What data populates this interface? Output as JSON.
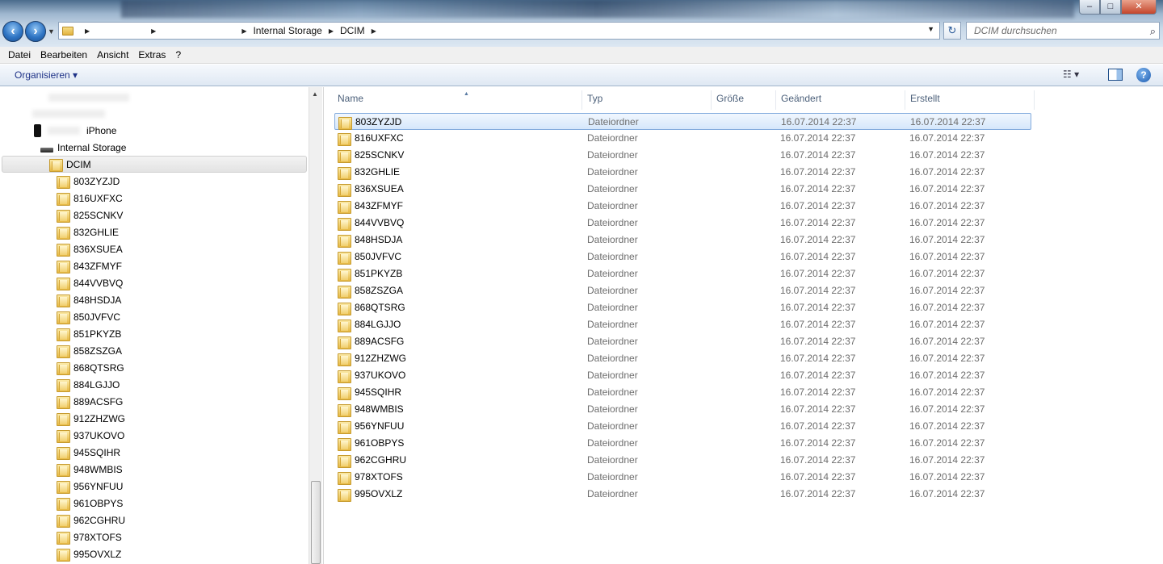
{
  "window": {
    "buttons": {
      "minimize": "–",
      "maximize": "□",
      "close": "✕"
    }
  },
  "address": {
    "crumbs": [
      "Internal Storage",
      "DCIM"
    ],
    "dropdown_icon": "chevron-down-icon"
  },
  "search": {
    "placeholder": "DCIM durchsuchen"
  },
  "menu": [
    "Datei",
    "Bearbeiten",
    "Ansicht",
    "Extras",
    "?"
  ],
  "commandbar": {
    "organize_label": "Organisieren ▾"
  },
  "nav": {
    "iphone_label": "iPhone",
    "internal_storage_label": "Internal Storage",
    "dcim_label": "DCIM",
    "folders": [
      "803ZYZJD",
      "816UXFXC",
      "825SCNKV",
      "832GHLIE",
      "836XSUEA",
      "843ZFMYF",
      "844VVBVQ",
      "848HSDJA",
      "850JVFVC",
      "851PKYZB",
      "858ZSZGA",
      "868QTSRG",
      "884LGJJO",
      "889ACSFG",
      "912ZHZWG",
      "937UKOVO",
      "945SQIHR",
      "948WMBIS",
      "956YNFUU",
      "961OBPYS",
      "962CGHRU",
      "978XTOFS",
      "995OVXLZ"
    ]
  },
  "columns": {
    "name": "Name",
    "type": "Typ",
    "size": "Größe",
    "modified": "Geändert",
    "created": "Erstellt"
  },
  "files": [
    {
      "name": "803ZYZJD",
      "type": "Dateiordner",
      "modified": "16.07.2014 22:37",
      "created": "16.07.2014 22:37"
    },
    {
      "name": "816UXFXC",
      "type": "Dateiordner",
      "modified": "16.07.2014 22:37",
      "created": "16.07.2014 22:37"
    },
    {
      "name": "825SCNKV",
      "type": "Dateiordner",
      "modified": "16.07.2014 22:37",
      "created": "16.07.2014 22:37"
    },
    {
      "name": "832GHLIE",
      "type": "Dateiordner",
      "modified": "16.07.2014 22:37",
      "created": "16.07.2014 22:37"
    },
    {
      "name": "836XSUEA",
      "type": "Dateiordner",
      "modified": "16.07.2014 22:37",
      "created": "16.07.2014 22:37"
    },
    {
      "name": "843ZFMYF",
      "type": "Dateiordner",
      "modified": "16.07.2014 22:37",
      "created": "16.07.2014 22:37"
    },
    {
      "name": "844VVBVQ",
      "type": "Dateiordner",
      "modified": "16.07.2014 22:37",
      "created": "16.07.2014 22:37"
    },
    {
      "name": "848HSDJA",
      "type": "Dateiordner",
      "modified": "16.07.2014 22:37",
      "created": "16.07.2014 22:37"
    },
    {
      "name": "850JVFVC",
      "type": "Dateiordner",
      "modified": "16.07.2014 22:37",
      "created": "16.07.2014 22:37"
    },
    {
      "name": "851PKYZB",
      "type": "Dateiordner",
      "modified": "16.07.2014 22:37",
      "created": "16.07.2014 22:37"
    },
    {
      "name": "858ZSZGA",
      "type": "Dateiordner",
      "modified": "16.07.2014 22:37",
      "created": "16.07.2014 22:37"
    },
    {
      "name": "868QTSRG",
      "type": "Dateiordner",
      "modified": "16.07.2014 22:37",
      "created": "16.07.2014 22:37"
    },
    {
      "name": "884LGJJO",
      "type": "Dateiordner",
      "modified": "16.07.2014 22:37",
      "created": "16.07.2014 22:37"
    },
    {
      "name": "889ACSFG",
      "type": "Dateiordner",
      "modified": "16.07.2014 22:37",
      "created": "16.07.2014 22:37"
    },
    {
      "name": "912ZHZWG",
      "type": "Dateiordner",
      "modified": "16.07.2014 22:37",
      "created": "16.07.2014 22:37"
    },
    {
      "name": "937UKOVO",
      "type": "Dateiordner",
      "modified": "16.07.2014 22:37",
      "created": "16.07.2014 22:37"
    },
    {
      "name": "945SQIHR",
      "type": "Dateiordner",
      "modified": "16.07.2014 22:37",
      "created": "16.07.2014 22:37"
    },
    {
      "name": "948WMBIS",
      "type": "Dateiordner",
      "modified": "16.07.2014 22:37",
      "created": "16.07.2014 22:37"
    },
    {
      "name": "956YNFUU",
      "type": "Dateiordner",
      "modified": "16.07.2014 22:37",
      "created": "16.07.2014 22:37"
    },
    {
      "name": "961OBPYS",
      "type": "Dateiordner",
      "modified": "16.07.2014 22:37",
      "created": "16.07.2014 22:37"
    },
    {
      "name": "962CGHRU",
      "type": "Dateiordner",
      "modified": "16.07.2014 22:37",
      "created": "16.07.2014 22:37"
    },
    {
      "name": "978XTOFS",
      "type": "Dateiordner",
      "modified": "16.07.2014 22:37",
      "created": "16.07.2014 22:37"
    },
    {
      "name": "995OVXLZ",
      "type": "Dateiordner",
      "modified": "16.07.2014 22:37",
      "created": "16.07.2014 22:37"
    }
  ],
  "selected_index": 0,
  "colors": {
    "selection_border": "#84acdd",
    "selection_fill": "#d5e7fb",
    "header_text": "#4c607a"
  }
}
